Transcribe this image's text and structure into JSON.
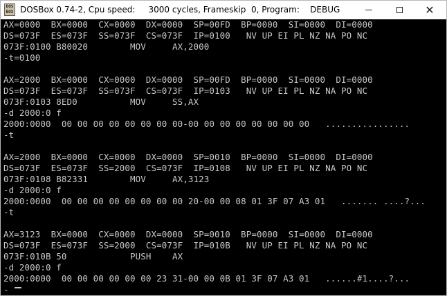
{
  "window": {
    "title": "DOSBox 0.74-2, Cpu speed:     3000 cycles, Frameskip  0, Program:    DEBUG",
    "icon_text": [
      "DOS",
      "BOX"
    ],
    "controls": {
      "minimize": "minimize-icon",
      "maximize": "maximize-icon",
      "close": "✕"
    }
  },
  "console": {
    "lines": [
      "AX=0000  BX=0000  CX=0000  DX=0000  SP=00FD  BP=0000  SI=0000  DI=0000",
      "DS=073F  ES=073F  SS=073F  CS=073F  IP=0100   NV UP EI PL NZ NA PO NC",
      "073F:0100 B80020        MOV     AX,2000",
      "-t=0100",
      "",
      "AX=2000  BX=0000  CX=0000  DX=0000  SP=00FD  BP=0000  SI=0000  DI=0000",
      "DS=073F  ES=073F  SS=073F  CS=073F  IP=0103   NV UP EI PL NZ NA PO NC",
      "073F:0103 8ED0          MOV     SS,AX",
      "-d 2000:0 f",
      "2000:0000  00 00 00 00 00 00 00 00-00 00 00 00 00 00 00 00   ................",
      "-t",
      "",
      "AX=2000  BX=0000  CX=0000  DX=0000  SP=0010  BP=0000  SI=0000  DI=0000",
      "DS=073F  ES=073F  SS=2000  CS=073F  IP=0108   NV UP EI PL NZ NA PO NC",
      "073F:0108 B82331        MOV     AX,3123",
      "-d 2000:0 f",
      "2000:0000  00 00 00 00 00 00 00 00 20-00 00 08 01 3F 07 A3 01   ....... ....?...",
      "-t",
      "",
      "AX=3123  BX=0000  CX=0000  DX=0000  SP=0010  BP=0000  SI=0000  DI=0000",
      "DS=073F  ES=073F  SS=2000  CS=073F  IP=010B   NV UP EI PL NZ NA PO NC",
      "073F:010B 50            PUSH    AX",
      "-d 2000:0 f",
      "2000:0000  00 00 00 00 00 00 23 31-00 00 0B 01 3F 07 A3 01   ......#1....?...",
      "-"
    ]
  }
}
